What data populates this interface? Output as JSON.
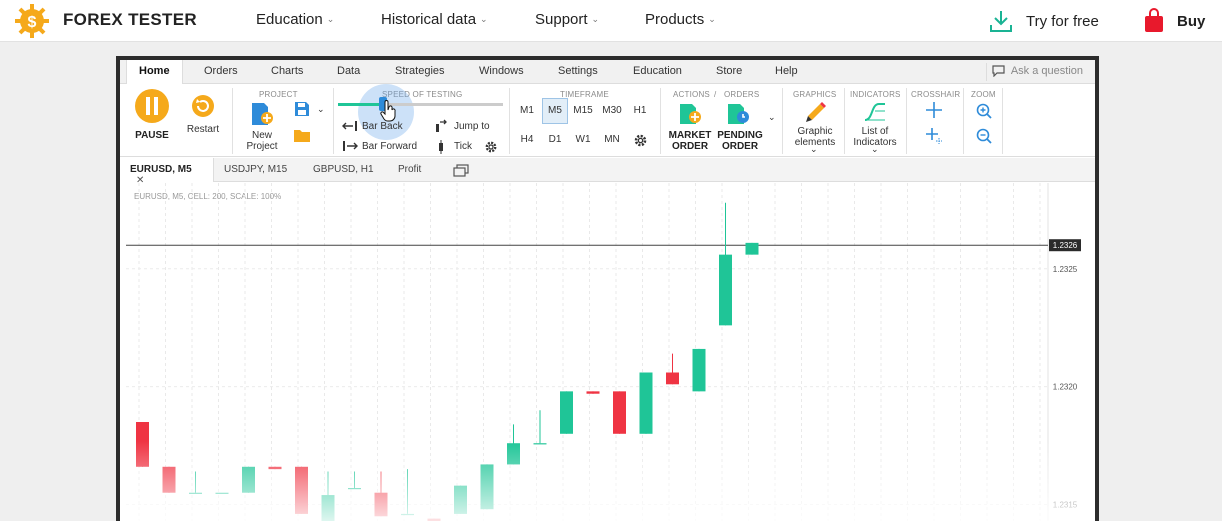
{
  "site": {
    "brand": "FOREX TESTER",
    "nav": [
      {
        "label": "Education"
      },
      {
        "label": "Historical data"
      },
      {
        "label": "Support"
      },
      {
        "label": "Products"
      }
    ],
    "try_label": "Try for free",
    "buy_label": "Buy",
    "colors": {
      "brand": "#f5a91b",
      "download": "#1ab394",
      "buy": "#e8192c"
    }
  },
  "app": {
    "menu": [
      "Home",
      "Orders",
      "Charts",
      "Data",
      "Strategies",
      "Windows",
      "Settings",
      "Education",
      "Store",
      "Help"
    ],
    "ask_placeholder": "Ask a question",
    "ribbon": {
      "pause_label": "PAUSE",
      "restart_label": "Restart",
      "project_title": "PROJECT",
      "new_project_line1": "New",
      "new_project_line2": "Project",
      "speed_title": "SPEED OF TESTING",
      "speed_level": 0.27,
      "bar_back": "Bar Back",
      "bar_forward": "Bar Forward",
      "jump_to": "Jump to",
      "tick": "Tick",
      "timeframe_title": "TIMEFRAME",
      "timeframes": [
        "M1",
        "M5",
        "M15",
        "M30",
        "H1",
        "H4",
        "D1",
        "W1",
        "MN"
      ],
      "selected_timeframe": "M5",
      "actions_title": "ACTIONS",
      "orders_title": "ORDERS",
      "market_order_1": "MARKET",
      "market_order_2": "ORDER",
      "pending_order_1": "PENDING",
      "pending_order_2": "ORDER",
      "graphics_title": "GRAPHICS",
      "graphic_elements_1": "Graphic",
      "graphic_elements_2": "elements",
      "indicators_title": "INDICATORS",
      "list_indicators_1": "List of",
      "list_indicators_2": "Indicators",
      "crosshair_title": "CROSSHAIR",
      "zoom_title": "ZOOM"
    },
    "chart_tabs": [
      "EURUSD, M5",
      "USDJPY, M15",
      "GBPUSD, H1",
      "Profit"
    ],
    "chart_info": "EURUSD, M5, CELL: 200, SCALE: 100%",
    "price_labels": [
      "1.2325",
      "1.2320",
      "1.2315"
    ],
    "current_price": "1.2326",
    "colors": {
      "bull": "#1fc597",
      "bear": "#ef3443",
      "accent": "#2e8bd9"
    }
  },
  "chart_data": {
    "type": "candlestick",
    "ylim": [
      1.23143,
      1.23283
    ],
    "current_price": 1.2326,
    "candles": [
      {
        "o": 1.23185,
        "h": 1.23185,
        "c": 1.23166
      },
      {
        "o": 1.23166,
        "h": 1.23166,
        "c": 1.23155
      },
      {
        "o": 1.23155,
        "h": 1.23164,
        "c": 1.23155
      },
      {
        "o": 1.23155,
        "h": 1.23155,
        "c": 1.23155
      },
      {
        "o": 1.23155,
        "h": 1.23166,
        "c": 1.23166
      },
      {
        "o": 1.23166,
        "h": 1.23166,
        "c": 1.23165
      },
      {
        "o": 1.23166,
        "h": 1.23166,
        "c": 1.23146
      },
      {
        "o": 1.23143,
        "h": 1.23164,
        "c": 1.23154
      },
      {
        "o": 1.23157,
        "h": 1.23164,
        "c": 1.23157
      },
      {
        "o": 1.23155,
        "h": 1.23164,
        "c": 1.23145
      },
      {
        "o": 1.23146,
        "h": 1.23165,
        "c": 1.23146
      },
      {
        "o": 1.23144,
        "h": 1.23144,
        "c": 1.23143
      },
      {
        "o": 1.23146,
        "h": 1.23158,
        "c": 1.23158
      },
      {
        "o": 1.23148,
        "h": 1.23167,
        "c": 1.23167
      },
      {
        "o": 1.23167,
        "h": 1.23184,
        "c": 1.23176
      },
      {
        "o": 1.23176,
        "h": 1.2319,
        "c": 1.23176
      },
      {
        "o": 1.2318,
        "h": 1.23198,
        "c": 1.23198
      },
      {
        "o": 1.23198,
        "h": 1.23198,
        "c": 1.23197
      },
      {
        "o": 1.23198,
        "h": 1.23198,
        "c": 1.2318
      },
      {
        "o": 1.2318,
        "h": 1.23206,
        "c": 1.23206
      },
      {
        "o": 1.23206,
        "h": 1.23214,
        "c": 1.23201
      },
      {
        "o": 1.23198,
        "h": 1.23216,
        "c": 1.23216
      },
      {
        "o": 1.23226,
        "h": 1.23278,
        "c": 1.23256
      },
      {
        "o": 1.23256,
        "h": 1.23261,
        "c": 1.23261
      }
    ]
  }
}
